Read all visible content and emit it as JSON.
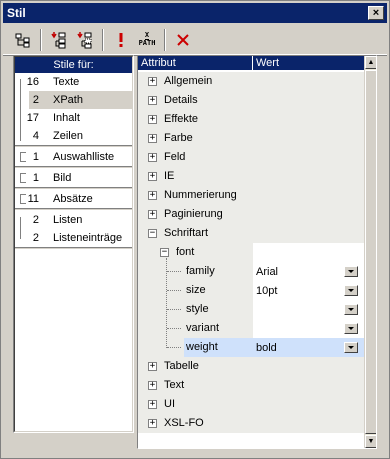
{
  "window": {
    "title": "Stil",
    "close_label": "×"
  },
  "toolbar": {
    "icons": [
      "tree-icon",
      "insert-style-icon",
      "append-style-icon",
      "exclamation-icon",
      "xpath-icon",
      "delete-icon"
    ],
    "xpath_label_top": "X",
    "xpath_label_bottom": "PATH"
  },
  "stile": {
    "header": "Stile für:",
    "items": [
      {
        "count": "16",
        "label": "Texte"
      },
      {
        "count": "2",
        "label": "XPath"
      },
      {
        "count": "17",
        "label": "Inhalt"
      },
      {
        "count": "4",
        "label": "Zeilen"
      },
      {
        "count": "1",
        "label": "Auswahlliste"
      },
      {
        "count": "1",
        "label": "Bild"
      },
      {
        "count": "11",
        "label": "Absätze"
      },
      {
        "count": "2",
        "label": "Listen"
      },
      {
        "count": "2",
        "label": "Listeneinträge"
      }
    ]
  },
  "grid": {
    "col_attr": "Attribut",
    "col_wert": "Wert",
    "categories_top": [
      "Allgemein",
      "Details",
      "Effekte",
      "Farbe",
      "Feld",
      "IE",
      "Nummerierung",
      "Paginierung",
      "Schriftart"
    ],
    "font_group": "font",
    "font_props": [
      {
        "name": "family",
        "value": "Arial"
      },
      {
        "name": "size",
        "value": "10pt"
      },
      {
        "name": "style",
        "value": ""
      },
      {
        "name": "variant",
        "value": ""
      },
      {
        "name": "weight",
        "value": "bold"
      }
    ],
    "categories_bottom": [
      "Tabelle",
      "Text",
      "UI",
      "XSL-FO"
    ],
    "expand_glyph": "+",
    "collapse_glyph": "−"
  },
  "colors": {
    "title_bar": "#0a246a",
    "face": "#d4d0c8",
    "highlight": "#cfe1fb",
    "delete_red": "#cc0000"
  }
}
